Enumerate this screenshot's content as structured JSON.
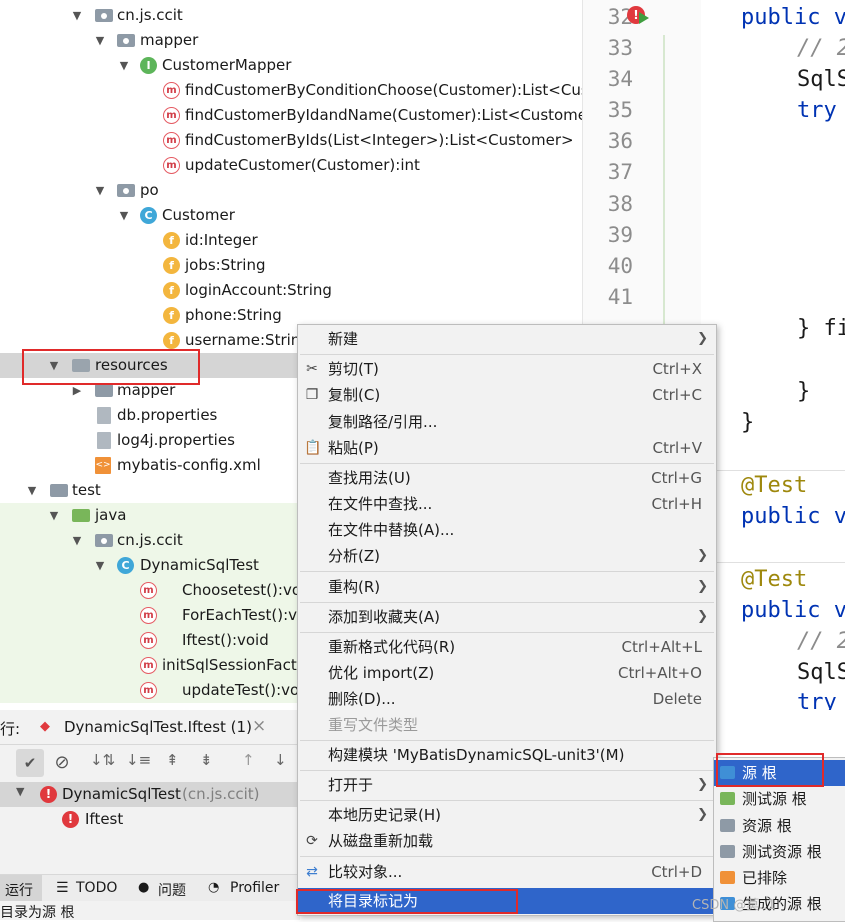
{
  "tree": {
    "rows": [
      {
        "label": "cn.js.ccit"
      },
      {
        "label": "mapper"
      },
      {
        "label": "CustomerMapper",
        "icon": "I"
      },
      {
        "label": "findCustomerByConditionChoose(Customer):List<Cust",
        "icon": "m"
      },
      {
        "label": "findCustomerByIdandName(Customer):List<Customer>",
        "icon": "m"
      },
      {
        "label": "findCustomerByIds(List<Integer>):List<Customer>",
        "icon": "m"
      },
      {
        "label": "updateCustomer(Customer):int",
        "icon": "m"
      },
      {
        "label": "po"
      },
      {
        "label": "Customer",
        "icon": "C"
      },
      {
        "label": "id:Integer",
        "icon": "f"
      },
      {
        "label": "jobs:String",
        "icon": "f"
      },
      {
        "label": "loginAccount:String",
        "icon": "f"
      },
      {
        "label": "phone:String",
        "icon": "f"
      },
      {
        "label": "username:String",
        "icon": "f"
      },
      {
        "label": "resources"
      },
      {
        "label": "mapper"
      },
      {
        "label": "db.properties"
      },
      {
        "label": "log4j.properties"
      },
      {
        "label": "mybatis-config.xml"
      },
      {
        "label": "test"
      },
      {
        "label": "java"
      },
      {
        "label": "cn.js.ccit"
      },
      {
        "label": "DynamicSqlTest",
        "icon": "C"
      },
      {
        "label": "Choosetest():void",
        "icon": "m"
      },
      {
        "label": "ForEachTest():void",
        "icon": "m"
      },
      {
        "label": "Iftest():void",
        "icon": "m"
      },
      {
        "label": "initSqlSessionFactory",
        "icon": "m"
      },
      {
        "label": "updateTest():void",
        "icon": "m"
      }
    ]
  },
  "editor": {
    "line_numbers": [
      "32",
      "33",
      "34",
      "35",
      "36",
      "37",
      "38",
      "39",
      "40",
      "41"
    ],
    "code": {
      "l32": "public v",
      "l33": "// 2",
      "l34": "SqlS",
      "l35": "try",
      "l41b": "} fi",
      "close1": "}",
      "close2": "}",
      "ann1": "@Test",
      "pub1": "public v",
      "ann2": "@Test",
      "pub2": "public v",
      "c2": "// 2",
      "s2": "SqlS",
      "t2": "try"
    }
  },
  "run_panel": {
    "tab_prefix": "行:",
    "tab_title": "DynamicSqlTest.Iftest (1)",
    "close": "×",
    "result_class": "DynamicSqlTest",
    "result_pkg": "(cn.js.ccit)",
    "result_test": "Iftest",
    "bottom_tabs": [
      "运行",
      "TODO",
      "问题",
      "Profiler"
    ],
    "status": "目录为源 根"
  },
  "context_menu": {
    "items": [
      {
        "label": "新建",
        "shortcut": "",
        "submenu": true
      },
      {
        "label": "剪切(T)",
        "shortcut": "Ctrl+X",
        "icon": "scissors"
      },
      {
        "label": "复制(C)",
        "shortcut": "Ctrl+C",
        "icon": "copy"
      },
      {
        "label": "复制路径/引用...",
        "shortcut": ""
      },
      {
        "label": "粘贴(P)",
        "shortcut": "Ctrl+V",
        "icon": "clipboard"
      },
      {
        "label": "查找用法(U)",
        "shortcut": "Ctrl+G"
      },
      {
        "label": "在文件中查找...",
        "shortcut": "Ctrl+H"
      },
      {
        "label": "在文件中替换(A)...",
        "shortcut": ""
      },
      {
        "label": "分析(Z)",
        "shortcut": "",
        "submenu": true
      },
      {
        "label": "重构(R)",
        "shortcut": "",
        "submenu": true
      },
      {
        "label": "添加到收藏夹(A)",
        "shortcut": "",
        "submenu": true
      },
      {
        "label": "重新格式化代码(R)",
        "shortcut": "Ctrl+Alt+L"
      },
      {
        "label": "优化 import(Z)",
        "shortcut": "Ctrl+Alt+O"
      },
      {
        "label": "删除(D)...",
        "shortcut": "Delete"
      },
      {
        "label": "重写文件类型",
        "shortcut": "",
        "disabled": true
      },
      {
        "label": "构建模块 'MyBatisDynamicSQL-unit3'(M)",
        "shortcut": ""
      },
      {
        "label": "打开于",
        "shortcut": "",
        "submenu": true
      },
      {
        "label": "本地历史记录(H)",
        "shortcut": "",
        "submenu": true
      },
      {
        "label": "从磁盘重新加载",
        "shortcut": "",
        "icon": "reload"
      },
      {
        "label": "比较对象...",
        "shortcut": "Ctrl+D",
        "icon": "compare"
      },
      {
        "label": "将目录标记为",
        "shortcut": "",
        "highlighted": true
      }
    ]
  },
  "submenu": {
    "items": [
      {
        "label": "源 根",
        "color": "#3f8fd6"
      },
      {
        "label": "测试源 根",
        "color": "#79b65a"
      },
      {
        "label": "资源 根",
        "color": "#8e9aa6"
      },
      {
        "label": "测试资源 根",
        "color": "#8e9aa6"
      },
      {
        "label": "已排除",
        "color": "#f09138"
      },
      {
        "label": "生成的源 根",
        "color": "#3f8fd6"
      }
    ]
  },
  "watermark": "CSDN @莫..1",
  "colors": {
    "highlight": "#2f65ca",
    "selection": "#d5d5d5",
    "redbox": "#e02a2a"
  }
}
